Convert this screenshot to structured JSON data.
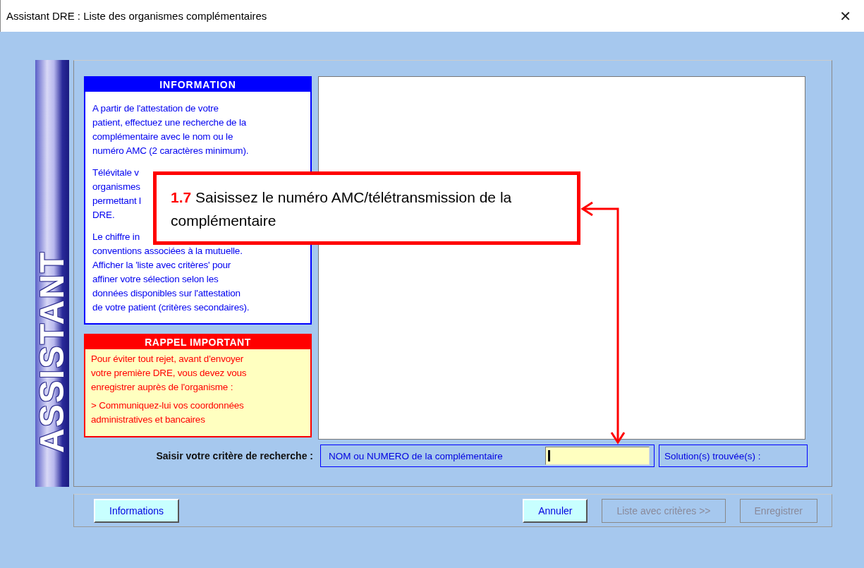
{
  "window": {
    "title": "Assistant DRE : Liste des organismes complémentaires",
    "close": "✕"
  },
  "sidebar": {
    "label": "ASSISTANT"
  },
  "information": {
    "title": "INFORMATION",
    "paragraphs": [
      [
        "A partir de l'attestation de votre",
        "patient, effectuez une recherche de la",
        "complémentaire avec le nom ou le",
        "numéro AMC (2 caractères minimum)."
      ],
      [
        "Télévitale v",
        "organismes",
        "permettant l",
        "DRE."
      ],
      [
        "Le chiffre in",
        "conventions associées à la mutuelle.",
        "Afficher la 'liste avec critères' pour",
        "affiner votre sélection selon les",
        "données disponibles sur l'attestation",
        "de votre patient (critères secondaires)."
      ]
    ]
  },
  "reminder": {
    "title": "RAPPEL IMPORTANT",
    "paragraphs": [
      [
        "Pour éviter tout rejet, avant d'envoyer",
        "votre première DRE, vous devez vous",
        "enregistrer auprès de l'organisme :"
      ],
      [
        "> Communiquez-lui vos coordonnées",
        "administratives et bancaires"
      ]
    ]
  },
  "search": {
    "label": "Saisir votre critère de recherche :",
    "field_label": "NOM ou NUMERO de la complémentaire",
    "results_label": "Solution(s) trouvée(s) :"
  },
  "left_buttons": [
    {
      "label": "Informations",
      "disabled": false
    }
  ],
  "right_buttons": [
    {
      "label": "Annuler",
      "disabled": false
    },
    {
      "label": "Liste avec critères >>",
      "disabled": true
    },
    {
      "label": "Enregistrer",
      "disabled": true
    }
  ],
  "callout": {
    "step": "1.7",
    "text": "Saisissez le numéro AMC/télétransmission de la complémentaire"
  }
}
